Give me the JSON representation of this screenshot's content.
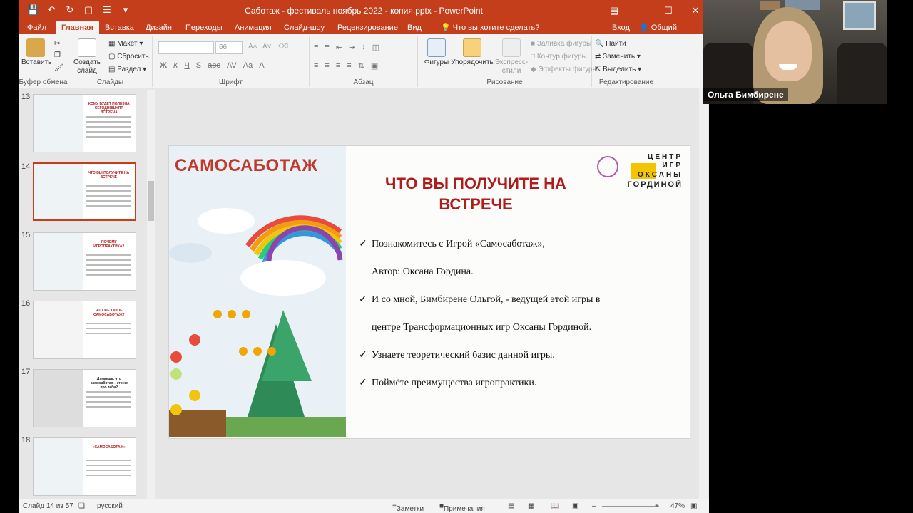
{
  "window": {
    "title": "Саботаж - фестиваль ноябрь 2022 - копия.pptx - PowerPoint"
  },
  "tabs": [
    "Файл",
    "Главная",
    "Вставка",
    "Дизайн",
    "Переходы",
    "Анимация",
    "Слайд-шоу",
    "Рецензирование",
    "Вид"
  ],
  "tell_me": "Что вы хотите сделать?",
  "signin": "Вход",
  "share": "Общий доступ",
  "ribbon": {
    "clipboard": {
      "paste": "Вставить",
      "label": "Буфер обмена"
    },
    "slides": {
      "new_slide": "Создать слайд",
      "layout": "Макет",
      "reset": "Сбросить",
      "section": "Раздел",
      "label": "Слайды"
    },
    "font": {
      "size": "66",
      "label": "Шрифт"
    },
    "paragraph": {
      "label": "Абзац"
    },
    "drawing": {
      "shapes": "Фигуры",
      "arrange": "Упорядочить",
      "quick_styles": "Экспресс-стили",
      "fill": "Заливка фигуры",
      "outline": "Контур фигуры",
      "effects": "Эффекты фигуры",
      "label": "Рисование"
    },
    "editing": {
      "find": "Найти",
      "replace": "Заменить",
      "select": "Выделить",
      "label": "Редактирование"
    }
  },
  "thumbnails": [
    {
      "num": "13",
      "title": "КОМУ БУДЕТ ПОЛЕЗНА СЕГОДНЯШНЯЯ ВСТРЕЧА"
    },
    {
      "num": "14",
      "title": "ЧТО ВЫ ПОЛУЧИТЕ НА ВСТРЕЧЕ"
    },
    {
      "num": "15",
      "title": "ПОЧЕМУ ИГРОПРАКТИКА?"
    },
    {
      "num": "16",
      "title": "ЧТО ЖЕ ТАКОЕ САМОСАБОТАЖ?"
    },
    {
      "num": "17",
      "title": "Думаешь, что самосаботаж - это не про тебя?"
    },
    {
      "num": "18",
      "title": "«САМОСАБОТАЖ»"
    }
  ],
  "slide": {
    "brand": "САМОСАБОТАЖ",
    "title_line1": "ЧТО ВЫ ПОЛУЧИТЕ НА",
    "title_line2": "ВСТРЕЧЕ",
    "logo": {
      "l1": "ЦЕНТР",
      "l2": "ИГР",
      "l3": "ОКСАНЫ",
      "l4": "ГОРДИНОЙ"
    },
    "bullets": [
      {
        "check": true,
        "text": "Познакомитесь с Игрой «Самосаботаж»,"
      },
      {
        "check": false,
        "text": "Автор: Оксана Гордина."
      },
      {
        "check": true,
        "text": "И со мной, Бимбирене Ольгой, - ведущей этой игры в"
      },
      {
        "check": false,
        "text": "центре Трансформационных игр Оксаны Гординой."
      },
      {
        "check": true,
        "text": "Узнаете теоретический базис данной игры."
      },
      {
        "check": true,
        "text": "Поймёте преимущества игропрактики."
      }
    ]
  },
  "status": {
    "slide_counter": "Слайд 14 из 57",
    "language": "русский",
    "notes": "Заметки",
    "comments": "Примечания",
    "zoom": "47%"
  },
  "participant": {
    "name": "Ольга Бимбирене"
  },
  "colors": {
    "accent": "#c43e1c",
    "title": "#b01c1c"
  }
}
